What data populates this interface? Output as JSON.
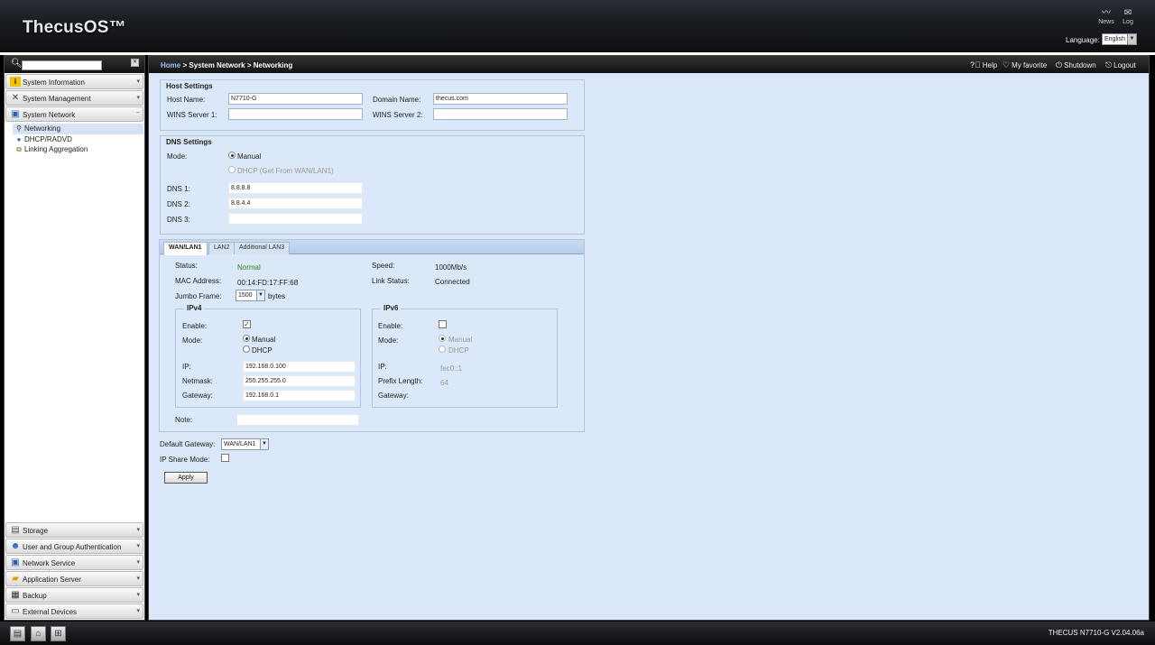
{
  "header": {
    "logo": "ThecusOS™",
    "news": "News",
    "log": "Log",
    "language_label": "Language:",
    "language_value": "English"
  },
  "sidebar": {
    "top_menus": [
      {
        "label": "System Information",
        "icon": "info-icon"
      },
      {
        "label": "System Management",
        "icon": "tools-icon"
      },
      {
        "label": "System Network",
        "icon": "network-icon"
      }
    ],
    "network_items": [
      {
        "label": "Networking",
        "icon": "ethernet-icon"
      },
      {
        "label": "DHCP/RADVD",
        "icon": "globe-icon"
      },
      {
        "label": "Linking Aggregation",
        "icon": "aggregation-icon"
      }
    ],
    "bottom_menus": [
      {
        "label": "Storage",
        "icon": "storage-icon"
      },
      {
        "label": "User and Group Authentication",
        "icon": "users-icon"
      },
      {
        "label": "Network Service",
        "icon": "network-service-icon"
      },
      {
        "label": "Application Server",
        "icon": "app-server-icon"
      },
      {
        "label": "Backup",
        "icon": "backup-icon"
      },
      {
        "label": "External Devices",
        "icon": "external-devices-icon"
      }
    ]
  },
  "breadcrumb": {
    "home": "Home",
    "sep": " > ",
    "level1": "System Network",
    "level2": "Networking"
  },
  "toolbar": {
    "help": "Help",
    "favorite": "My favorite",
    "shutdown": "Shutdown",
    "logout": "Logout"
  },
  "host_settings": {
    "title": "Host Settings",
    "host_name_label": "Host Name:",
    "host_name_value": "N7710-G",
    "domain_name_label": "Domain Name:",
    "domain_name_value": "thecus.com",
    "wins1_label": "WINS Server 1:",
    "wins1_value": "",
    "wins2_label": "WINS Server 2:",
    "wins2_value": ""
  },
  "dns_settings": {
    "title": "DNS Settings",
    "mode_label": "Mode:",
    "mode_manual": "Manual",
    "mode_dhcp": "DHCP (Get From WAN/LAN1)",
    "dns1_label": "DNS 1:",
    "dns1_value": "8.8.8.8",
    "dns2_label": "DNS 2:",
    "dns2_value": "8.8.4.4",
    "dns3_label": "DNS 3:",
    "dns3_value": ""
  },
  "tabs": [
    "WAN/LAN1",
    "LAN2",
    "Additional LAN3"
  ],
  "interface": {
    "status_label": "Status:",
    "status_value": "Normal",
    "speed_label": "Speed:",
    "speed_value": "1000Mb/s",
    "mac_label": "MAC Address:",
    "mac_value": "00:14:FD:17:FF:68",
    "link_label": "Link Status:",
    "link_value": "Connected",
    "jumbo_label": "Jumbo Frame:",
    "jumbo_value": "1500",
    "jumbo_unit": "bytes",
    "note_label": "Note:",
    "note_value": ""
  },
  "ipv4": {
    "title": "IPv4",
    "enable_label": "Enable:",
    "enabled": true,
    "mode_label": "Mode:",
    "mode_manual": "Manual",
    "mode_dhcp": "DHCP",
    "ip_label": "IP:",
    "ip_value": "192.168.0.100",
    "netmask_label": "Netmask:",
    "netmask_value": "255.255.255.0",
    "gateway_label": "Gateway:",
    "gateway_value": "192.168.0.1"
  },
  "ipv6": {
    "title": "IPv6",
    "enable_label": "Enable:",
    "enabled": false,
    "mode_label": "Mode:",
    "mode_manual": "Manual",
    "mode_dhcp": "DHCP",
    "ip_label": "IP:",
    "ip_value": "fec0::1",
    "prefix_label": "Prefix Length:",
    "prefix_value": "64",
    "gateway_label": "Gateway:"
  },
  "global": {
    "default_gateway_label": "Default Gateway:",
    "default_gateway_value": "WAN/LAN1",
    "ip_share_label": "IP Share Mode:",
    "apply_label": "Apply"
  },
  "footer": {
    "version": "THECUS N7710-G V2.04.06a"
  },
  "colors": {
    "content_bg": "#d9e7f9",
    "status_ok": "#268a1c",
    "link_home": "#9ec2ff"
  }
}
